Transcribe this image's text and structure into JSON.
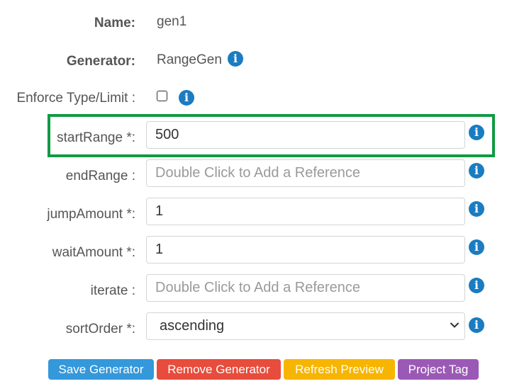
{
  "form": {
    "name": {
      "label": "Name:",
      "value": "gen1"
    },
    "generator": {
      "label": "Generator:",
      "value": "RangeGen"
    },
    "enforce": {
      "label": "Enforce Type/Limit :",
      "checked": false
    },
    "startRange": {
      "label": "startRange *:",
      "value": "500"
    },
    "endRange": {
      "label": "endRange :",
      "value": "",
      "placeholder": "Double Click to Add a Reference"
    },
    "jumpAmount": {
      "label": "jumpAmount *:",
      "value": "1"
    },
    "waitAmount": {
      "label": "waitAmount *:",
      "value": "1"
    },
    "iterate": {
      "label": "iterate :",
      "value": "",
      "placeholder": "Double Click to Add a Reference"
    },
    "sortOrder": {
      "label": "sortOrder *:",
      "value": "ascending"
    }
  },
  "info_icon": {
    "glyph": "i",
    "icon": "info-circle-icon",
    "color": "#1a7cc1"
  },
  "buttons": {
    "save": {
      "label": "Save Generator",
      "color": "#3498db"
    },
    "remove": {
      "label": "Remove Generator",
      "color": "#e74c3c"
    },
    "refresh": {
      "label": "Refresh Preview",
      "color": "#f7b500"
    },
    "tag": {
      "label": "Project Tag",
      "color": "#9b59b6"
    }
  },
  "highlight_color": "#119a44"
}
